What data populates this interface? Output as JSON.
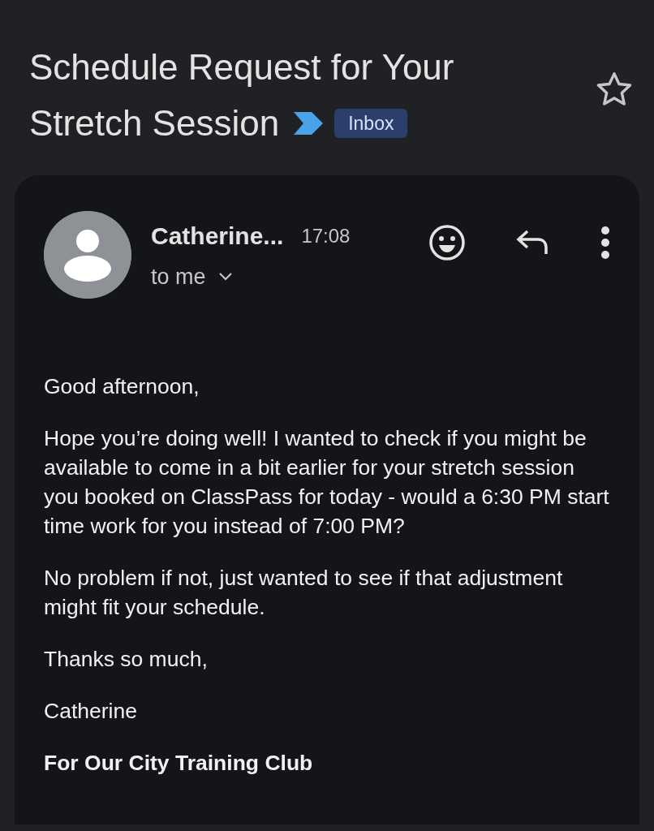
{
  "subject": {
    "title_lines": [
      "Schedule Request for Your",
      "Stretch Session"
    ],
    "label": "Inbox",
    "important": true,
    "starred": false
  },
  "message": {
    "sender": "Catherine...",
    "time": "17:08",
    "recipient": "to me",
    "paragraphs": [
      {
        "kind": "text",
        "text": "Good afternoon,"
      },
      {
        "kind": "text",
        "text": "Hope you’re doing well! I wanted to check if you might be available to come in a bit earlier for your stretch session you booked on ClassPass for today - would a 6:30 PM start time work for you instead of 7:00 PM?"
      },
      {
        "kind": "text",
        "text": "No problem if not, just wanted to see if that adjustment might fit your schedule."
      },
      {
        "kind": "text",
        "text": "Thanks so much,"
      },
      {
        "kind": "text",
        "text": "Catherine"
      },
      {
        "kind": "signature",
        "text": "For Our City Training Club"
      }
    ]
  }
}
